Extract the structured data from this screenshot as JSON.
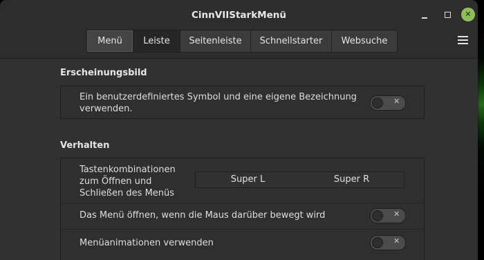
{
  "window": {
    "title": "CinnVIIStarkMenü",
    "close_glyph": "✕"
  },
  "tabs": [
    "Menü",
    "Leiste",
    "Seitenleiste",
    "Schnellstarter",
    "Websuche"
  ],
  "sections": {
    "appearance": {
      "title": "Erscheinungsbild",
      "custom_icon_label_line1": "Ein benutzerdefiniertes Symbol und eine eigene Bezeichnung",
      "custom_icon_label_line2": "verwenden.",
      "custom_icon_enabled": false
    },
    "behavior": {
      "title": "Verhalten",
      "hotkey_label_line1": "Tastenkombinationen",
      "hotkey_label_line2": "zum Öffnen und",
      "hotkey_label_line3": "Schließen des Menüs",
      "hotkey_primary": "Super L",
      "hotkey_secondary": "Super R",
      "hover_open_label": "Das Menü öffnen, wenn die Maus darüber bewegt wird",
      "hover_open_enabled": false,
      "animations_label": "Menüanimationen verwenden",
      "animations_enabled": false
    }
  },
  "toggle_off_glyph": "✕",
  "icons": {
    "menu": "hamburger-icon",
    "minimize": "minimize-icon",
    "maximize": "maximize-icon",
    "close": "close-icon"
  },
  "colors": {
    "accent": "#8fbe57",
    "window_bg": "#313131",
    "titlebar_bg": "#2d2d2d"
  }
}
